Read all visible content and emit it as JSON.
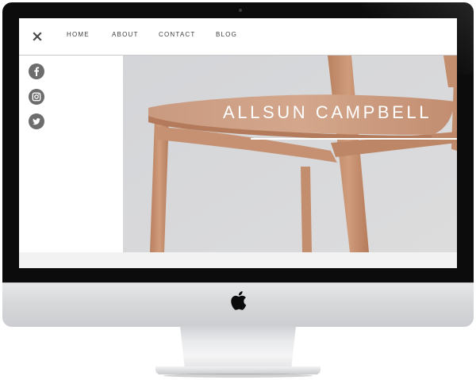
{
  "nav": {
    "items": [
      {
        "label": "HOME"
      },
      {
        "label": "ABOUT"
      },
      {
        "label": "CONTACT"
      },
      {
        "label": "BLOG"
      }
    ],
    "close_icon": "close-icon"
  },
  "social": [
    {
      "icon": "facebook-icon"
    },
    {
      "icon": "instagram-icon"
    },
    {
      "icon": "twitter-icon"
    }
  ],
  "hero": {
    "title": "ALLSUN CAMPBELL",
    "image": "wooden-chair-photo"
  },
  "device": {
    "logo": "apple-logo-icon"
  },
  "colors": {
    "bezel": "#0c0c0c",
    "chin": "#d6d8da",
    "social_icon_bg": "#6d6d6d",
    "hero_bg": "#d8d9db",
    "chair_wood": "#c89779",
    "title_text": "#ffffff"
  }
}
